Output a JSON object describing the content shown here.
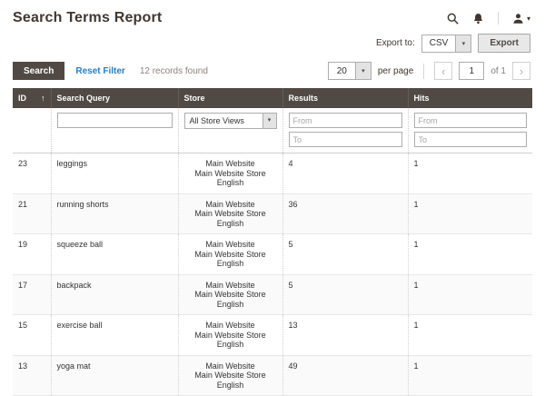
{
  "icons": {
    "caret": "▾",
    "sort_asc": "↑",
    "chevron_left": "‹",
    "chevron_right": "›"
  },
  "header": {
    "title": "Search Terms Report"
  },
  "export": {
    "label": "Export to:",
    "format": "CSV",
    "button": "Export"
  },
  "toolbar": {
    "search": "Search",
    "reset": "Reset Filter",
    "records": "12 records found",
    "per_page": "20",
    "per_page_label": "per page",
    "page": "1",
    "page_of": "of 1"
  },
  "table": {
    "columns": {
      "id": "ID",
      "query": "Search Query",
      "store": "Store",
      "results": "Results",
      "hits": "Hits"
    },
    "filters": {
      "store": "All Store Views",
      "from": "From",
      "to": "To"
    },
    "rows": [
      {
        "id": "23",
        "query": "leggings",
        "store": [
          "Main Website",
          "Main Website Store",
          "English"
        ],
        "results": "4",
        "hits": "1"
      },
      {
        "id": "21",
        "query": "running shorts",
        "store": [
          "Main Website",
          "Main Website Store",
          "English"
        ],
        "results": "36",
        "hits": "1"
      },
      {
        "id": "19",
        "query": "squeeze ball",
        "store": [
          "Main Website",
          "Main Website Store",
          "English"
        ],
        "results": "5",
        "hits": "1"
      },
      {
        "id": "17",
        "query": "backpack",
        "store": [
          "Main Website",
          "Main Website Store",
          "English"
        ],
        "results": "5",
        "hits": "1"
      },
      {
        "id": "15",
        "query": "exercise ball",
        "store": [
          "Main Website",
          "Main Website Store",
          "English"
        ],
        "results": "13",
        "hits": "1"
      },
      {
        "id": "13",
        "query": "yoga mat",
        "store": [
          "Main Website",
          "Main Website Store",
          "English"
        ],
        "results": "49",
        "hits": "1"
      }
    ]
  }
}
